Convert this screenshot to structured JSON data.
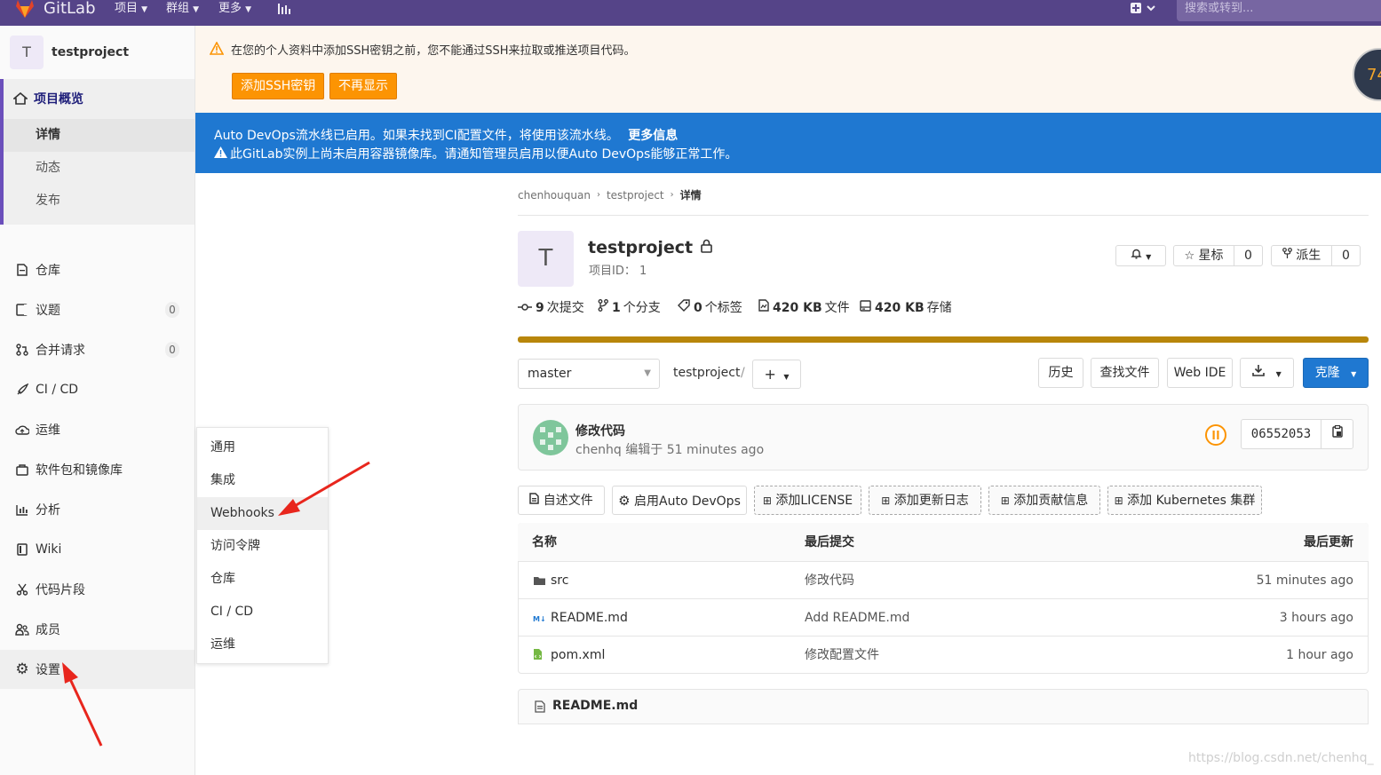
{
  "nav": {
    "brand": "GitLab",
    "items": [
      "项目",
      "群组",
      "更多"
    ],
    "search_placeholder": "搜索或转到...",
    "avatar_text": "74"
  },
  "sidebar": {
    "project_initial": "T",
    "project_name": "testproject",
    "overview": "项目概览",
    "overview_sub": [
      "详情",
      "动态",
      "发布"
    ],
    "items": [
      {
        "label": "仓库",
        "icon": "repository-icon"
      },
      {
        "label": "议题",
        "icon": "issues-icon",
        "badge": "0"
      },
      {
        "label": "合并请求",
        "icon": "merge-request-icon",
        "badge": "0"
      },
      {
        "label": "CI / CD",
        "icon": "rocket-icon"
      },
      {
        "label": "运维",
        "icon": "cloud-icon"
      },
      {
        "label": "软件包和镜像库",
        "icon": "package-icon"
      },
      {
        "label": "分析",
        "icon": "chart-icon"
      },
      {
        "label": "Wiki",
        "icon": "book-icon"
      },
      {
        "label": "代码片段",
        "icon": "scissors-icon"
      },
      {
        "label": "成员",
        "icon": "users-icon"
      },
      {
        "label": "设置",
        "icon": "gear-icon"
      }
    ]
  },
  "settings_flyout": [
    "通用",
    "集成",
    "Webhooks",
    "访问令牌",
    "仓库",
    "CI / CD",
    "运维"
  ],
  "alert_ssh": {
    "message": "在您的个人资料中添加SSH密钥之前，您不能通过SSH来拉取或推送项目代码。",
    "add_button": "添加SSH密钥",
    "dismiss_button": "不再显示"
  },
  "alert_devops": {
    "line1": "Auto DevOps流水线已启用。如果未找到CI配置文件，将使用该流水线。",
    "more_info": "更多信息",
    "line2": "此GitLab实例上尚未启用容器镜像库。请通知管理员启用以便Auto DevOps能够正常工作。"
  },
  "breadcrumb": [
    "chenhouquan",
    "testproject",
    "详情"
  ],
  "project": {
    "initial": "T",
    "name": "testproject",
    "id_label": "项目ID： 1",
    "star_label": "星标",
    "star_count": "0",
    "fork_label": "派生",
    "fork_count": "0"
  },
  "stats": [
    {
      "value": "9",
      "label": "次提交",
      "icon": "commit-icon"
    },
    {
      "value": "1",
      "label": "个分支",
      "icon": "branch-icon"
    },
    {
      "value": "0",
      "label": "个标签",
      "icon": "tag-icon"
    },
    {
      "value": "420 KB",
      "label": "文件",
      "icon": "file-icon"
    },
    {
      "value": "420 KB",
      "label": "存储",
      "icon": "storage-icon"
    }
  ],
  "toolbar": {
    "branch": "master",
    "path": "testproject",
    "history": "历史",
    "find_file": "查找文件",
    "web_ide": "Web IDE",
    "clone": "克隆"
  },
  "last_commit": {
    "title": "修改代码",
    "author_line": "chenhq 编辑于 51 minutes ago",
    "sha": "06552053"
  },
  "quick_buttons": [
    "自述文件",
    "启用Auto DevOps",
    "添加LICENSE",
    "添加更新日志",
    "添加贡献信息",
    "添加 Kubernetes 集群"
  ],
  "file_table": {
    "headers": [
      "名称",
      "最后提交",
      "最后更新"
    ],
    "rows": [
      {
        "name": "src",
        "commit": "修改代码",
        "updated": "51 minutes ago",
        "icon": "folder-icon"
      },
      {
        "name": "README.md",
        "commit": "Add README.md",
        "updated": "3 hours ago",
        "icon": "markdown-icon"
      },
      {
        "name": "pom.xml",
        "commit": "修改配置文件",
        "updated": "1 hour ago",
        "icon": "xml-file-icon"
      }
    ]
  },
  "readme_header": "README.md",
  "watermark": "https://blog.csdn.net/chenhq_",
  "colors": {
    "nav": "#554488",
    "accent_blue": "#1f78d1",
    "warning_orange": "#fc9403",
    "progress_bar": "#b8860b",
    "annotation_arrow": "#e8261d"
  }
}
